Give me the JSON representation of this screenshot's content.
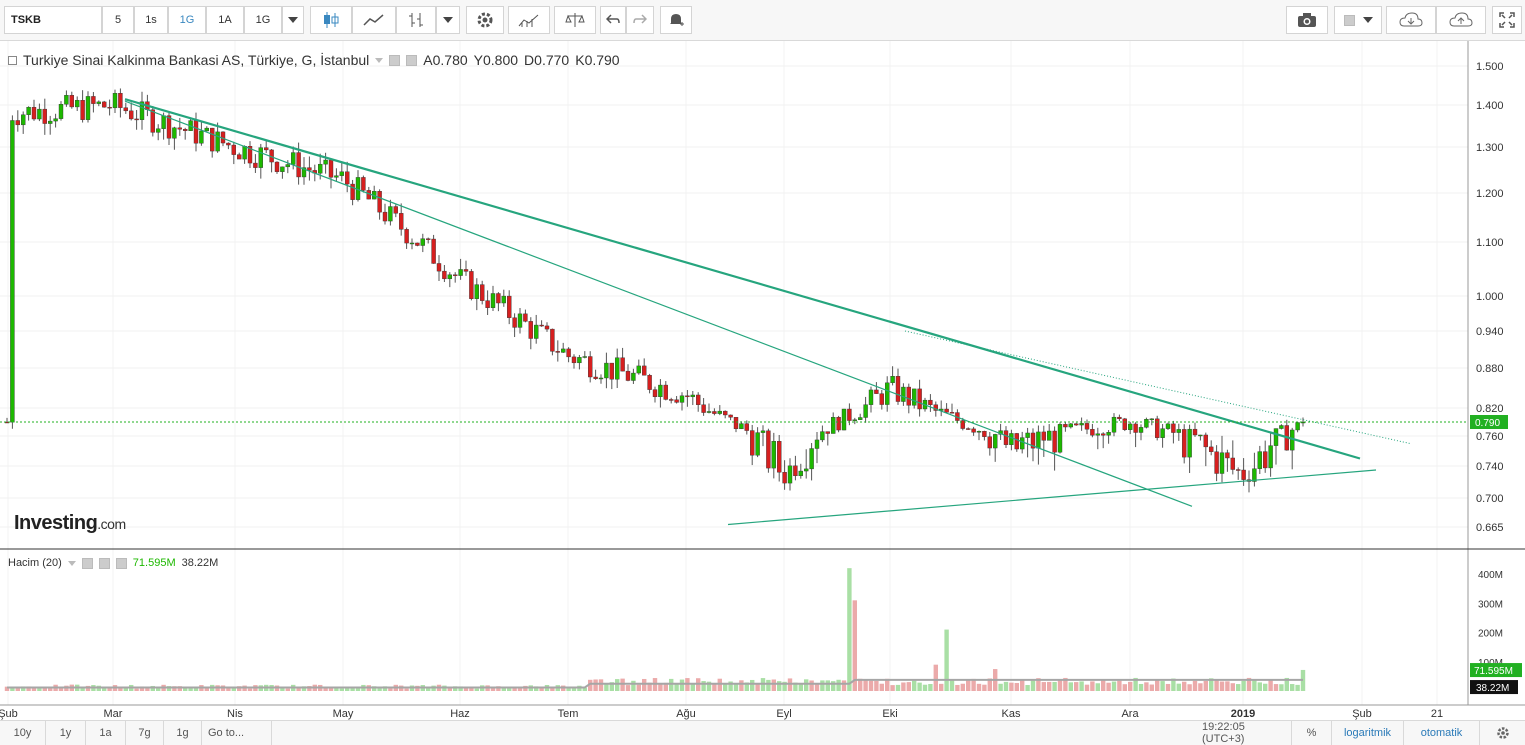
{
  "toolbar": {
    "symbol": "TSKB",
    "intervals": [
      "5",
      "1s",
      "1G",
      "1A",
      "1G"
    ],
    "active_interval": "1G"
  },
  "legend": {
    "title": "Turkiye Sinai Kalkinma Bankasi AS, Türkiye, G, İstanbul",
    "ohlc": [
      {
        "label": "A",
        "value": "0.780"
      },
      {
        "label": "Y",
        "value": "0.800"
      },
      {
        "label": "D",
        "value": "0.770"
      },
      {
        "label": "K",
        "value": "0.790"
      }
    ]
  },
  "volume_legend": {
    "title": "Hacim (20)",
    "value_green": "71.595M",
    "value_ma": "38.22M"
  },
  "logo": {
    "brand": "Investing",
    "suffix": ".com"
  },
  "colors": {
    "up": "#1db800",
    "down": "#d61f1f",
    "trend": "#26a57e",
    "price_line": "#22b022",
    "vol_up": "#a9dfa5",
    "vol_down": "#ebaaaa",
    "vol_ma": "#a6a6a6"
  },
  "bottom_bar": {
    "ranges": [
      "10y",
      "1y",
      "1a",
      "7g",
      "1g"
    ],
    "goto": "Go to...",
    "time": "19:22:05 (UTC+3)",
    "percent": "%",
    "log": "logaritmik",
    "auto": "otomatik"
  },
  "chart_data": [
    {
      "type": "candlestick",
      "title": "Turkiye Sinai Kalkinma Bankasi AS, Türkiye, G, İstanbul",
      "last_price": "0.790",
      "y_ticks": [
        "1.500",
        "1.400",
        "1.300",
        "1.200",
        "1.100",
        "1.000",
        "0.940",
        "0.880",
        "0.820",
        "0.760",
        "0.740",
        "0.700",
        "0.665"
      ],
      "x_ticks": [
        "Şub",
        "Mar",
        "Nis",
        "May",
        "Haz",
        "Tem",
        "Ağu",
        "Eyl",
        "Eki",
        "Kas",
        "Ara",
        "2019",
        "Şub",
        "21"
      ],
      "trendlines": [
        {
          "from": [
            "Mar",
            1.415
          ],
          "to": [
            "Oca",
            0.745
          ]
        },
        {
          "from": [
            "Mar",
            1.41
          ],
          "to": [
            "Ara",
            0.69
          ]
        },
        {
          "from": [
            "Ağu",
            0.668
          ],
          "to": [
            "Oca",
            0.735
          ]
        }
      ],
      "path": [
        {
          "m": "Şub",
          "v": 1.38
        },
        {
          "m": "Mar",
          "v": 1.4
        },
        {
          "m": "Nis",
          "v": 1.3
        },
        {
          "m": "May",
          "v": 1.23
        },
        {
          "m": "Haz",
          "v": 1.03
        },
        {
          "m": "Tem",
          "v": 0.9
        },
        {
          "m": "Ağu",
          "v": 0.84
        },
        {
          "m": "Eyl",
          "v": 0.73
        },
        {
          "m": "Eki",
          "v": 0.85
        },
        {
          "m": "Kas",
          "v": 0.75
        },
        {
          "m": "Ara",
          "v": 0.79
        },
        {
          "m": "2019",
          "v": 0.73
        },
        {
          "m": "Oca",
          "v": 0.79
        }
      ]
    },
    {
      "type": "bar",
      "title": "Hacim (20)",
      "y_ticks": [
        "400M",
        "300M",
        "200M",
        "100M"
      ],
      "last_volume": "71.595M",
      "ma_value": "38.22M"
    }
  ]
}
